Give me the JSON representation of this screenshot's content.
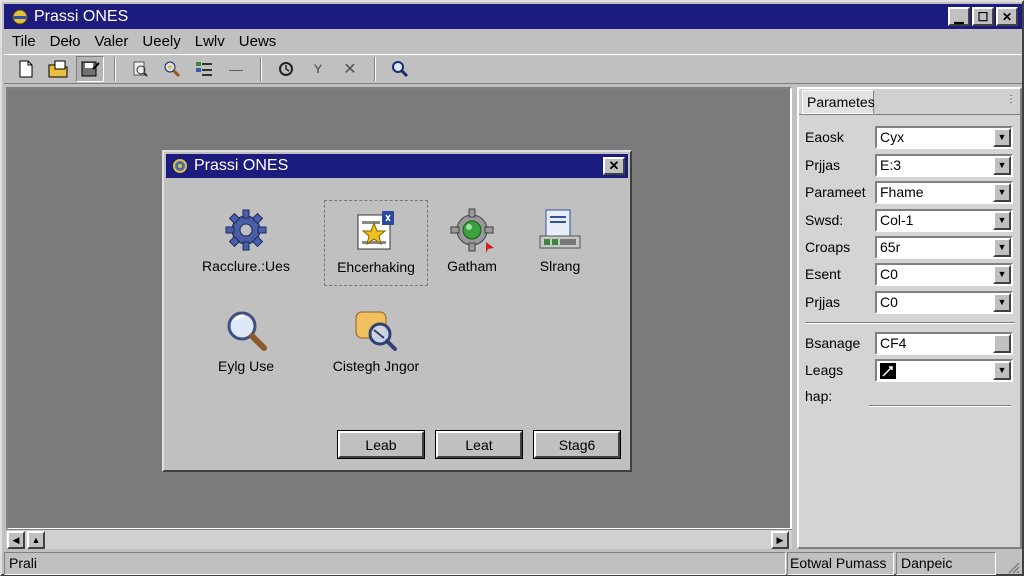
{
  "window": {
    "title": "Prassi ONES"
  },
  "menu": [
    "Tile",
    "Deło",
    "Valer",
    "Ueely",
    "Lwlv",
    "Uews"
  ],
  "dialog": {
    "title": "Prassi ONES",
    "items": [
      {
        "label": "Racclure.:Ues",
        "icon": "gear-icon"
      },
      {
        "label": "Ehcerhaking",
        "icon": "document-star-icon"
      },
      {
        "label": "Gatham",
        "icon": "green-gear-icon"
      },
      {
        "label": "Slrang",
        "icon": "report-icon"
      },
      {
        "label": "Eylg Use",
        "icon": "magnifier-icon"
      },
      {
        "label": "Cistegh Jngor",
        "icon": "search-folder-icon"
      }
    ],
    "buttons": [
      "Leab",
      "Leat",
      "Stag6"
    ]
  },
  "panel": {
    "tab": "Parametes",
    "rows": [
      {
        "label": "Eaosk",
        "value": "Cyx"
      },
      {
        "label": "Prjjas",
        "value": "E:3"
      },
      {
        "label": "Parameet",
        "value": "Fhame"
      },
      {
        "label": "Swsd:",
        "value": "Col-1"
      },
      {
        "label": "Croaps",
        "value": "65r"
      },
      {
        "label": "Esent",
        "value": "C0"
      },
      {
        "label": "Prjjas",
        "value": "C0"
      }
    ],
    "rows2": [
      {
        "label": "Bsanage",
        "value": "CF4"
      },
      {
        "label": "Leags",
        "value": ""
      },
      {
        "label": "hap:",
        "value": ""
      }
    ]
  },
  "status": {
    "left": "Prali",
    "mid": "Eotwal Pumass",
    "right": "Danpeic"
  },
  "colors": {
    "titlebar": "#1c1c7e",
    "workspace": "#7b7b7b",
    "chrome": "#c0c0c0"
  }
}
